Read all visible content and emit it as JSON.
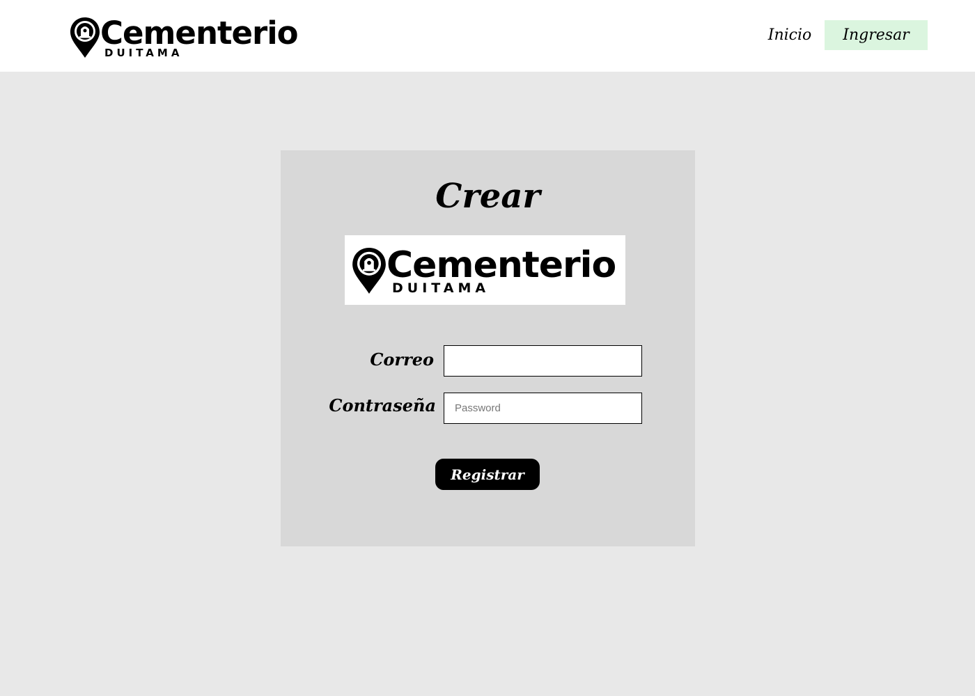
{
  "header": {
    "logo": {
      "brand": "Cementerio",
      "sub": "DUITAMA"
    },
    "nav": {
      "inicio_label": "Inicio",
      "ingresar_label": "Ingresar"
    }
  },
  "form": {
    "title": "Crear",
    "logo": {
      "brand": "Cementerio",
      "sub": "DUITAMA"
    },
    "correo": {
      "label": "Correo",
      "value": "",
      "placeholder": ""
    },
    "contrasena": {
      "label": "Contraseña",
      "value": "",
      "placeholder": "Password"
    },
    "submit_label": "Registrar"
  },
  "icons": {
    "logo": "location-pin-icon"
  },
  "colors": {
    "page_background": "#e8e8e8",
    "header_background": "#ffffff",
    "card_background": "#d8d8d8",
    "active_nav": "#dbf5df",
    "button": "#000000"
  }
}
